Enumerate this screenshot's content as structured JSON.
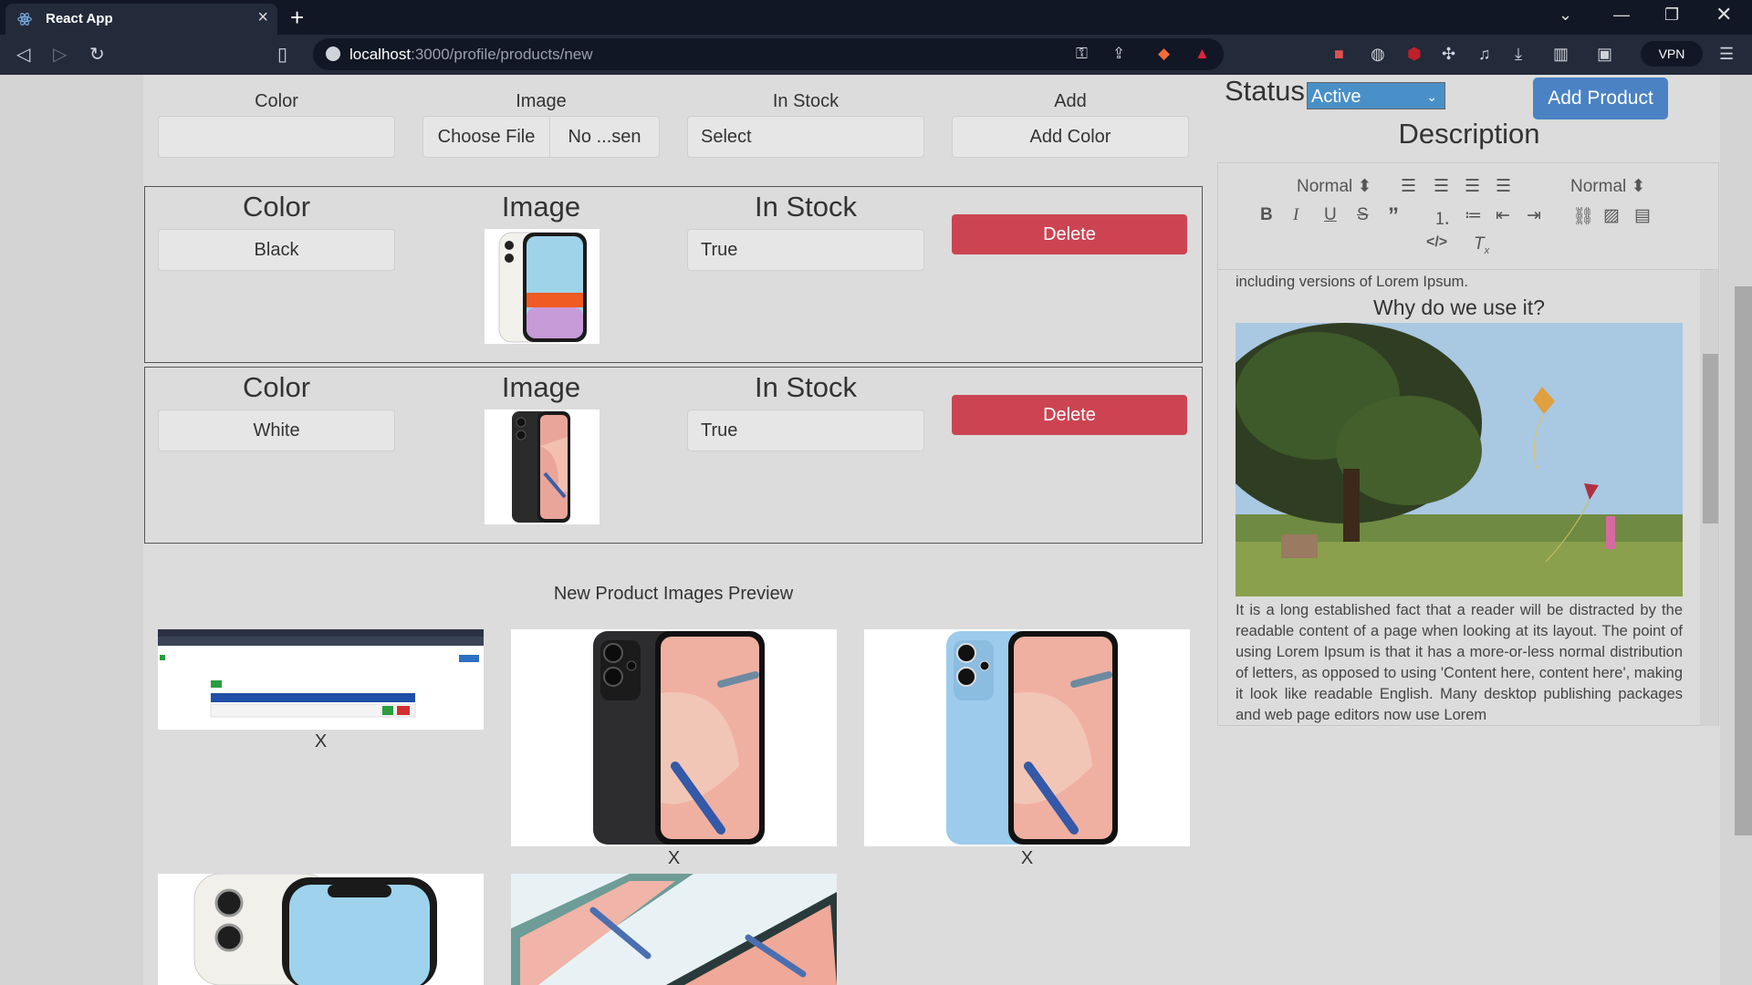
{
  "browser": {
    "tab_title": "React App",
    "url_host": "localhost",
    "url_rest": ":3000/profile/products/new",
    "vpn": "VPN"
  },
  "form": {
    "color_label": "Color",
    "image_label": "Image",
    "instock_label": "In Stock",
    "add_label": "Add",
    "choose_file": "Choose File",
    "no_file": "No ...sen",
    "select_placeholder": "Select",
    "add_color_button": "Add Color"
  },
  "variants": [
    {
      "color_label": "Color",
      "image_label": "Image",
      "instock_label": "In Stock",
      "color": "Black",
      "instock": "True",
      "delete": "Delete"
    },
    {
      "color_label": "Color",
      "image_label": "Image",
      "instock_label": "In Stock",
      "color": "White",
      "instock": "True",
      "delete": "Delete"
    }
  ],
  "preview": {
    "title": "New Product Images Preview",
    "remove_labels": [
      "X",
      "X",
      "X"
    ]
  },
  "status": {
    "label": "Status",
    "value": "Active",
    "add_product": "Add Product"
  },
  "description": {
    "title": "Description",
    "header_select": "Normal",
    "size_select": "Normal",
    "text_top": "including versions of Lorem Ipsum.",
    "heading": "Why do we use it?",
    "paragraph": "It is a long established fact that a reader will be distracted by the readable content of a page when looking at its layout. The point of using Lorem Ipsum is that it has a more-or-less normal distribution of letters, as opposed to using 'Content here, content here', making it look like readable English. Many desktop publishing packages and web page editors now use Lorem"
  }
}
